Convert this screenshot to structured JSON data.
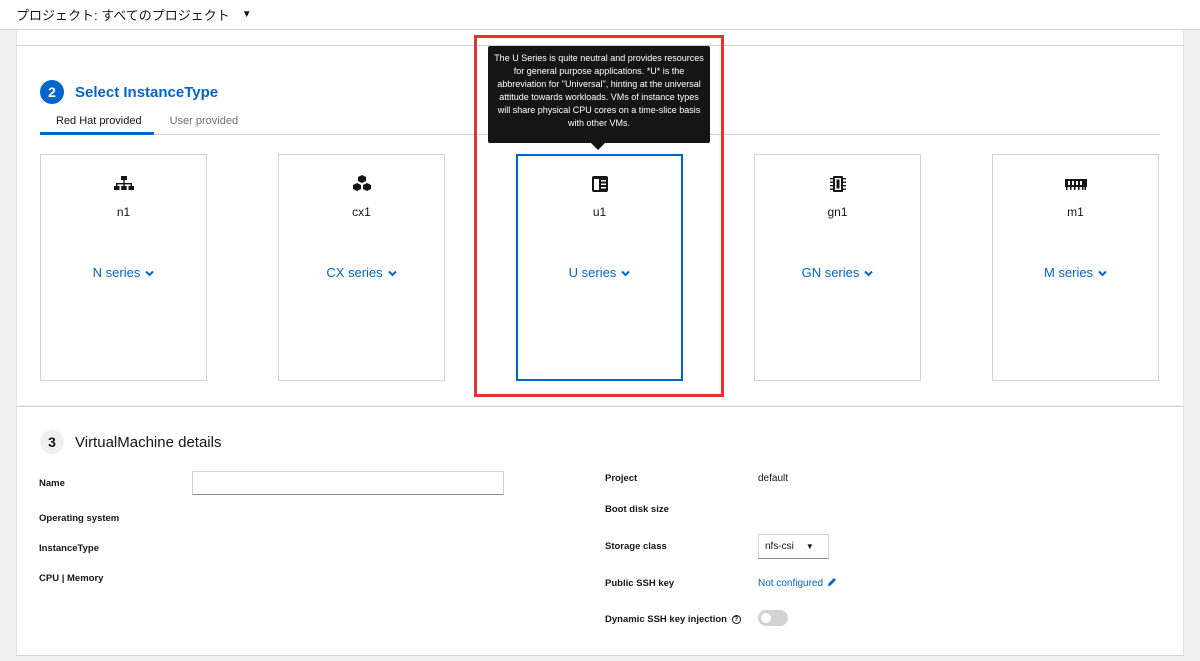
{
  "project_bar": {
    "label": "プロジェクト: すべてのプロジェクト"
  },
  "step2": {
    "number": "2",
    "title": "Select InstanceType"
  },
  "tabs": [
    {
      "label": "Red Hat provided",
      "active": true
    },
    {
      "label": "User provided",
      "active": false
    }
  ],
  "cards": [
    {
      "icon": "network-hierarchy-icon",
      "name": "n1",
      "series": "N series",
      "selected": false
    },
    {
      "icon": "cubes-icon",
      "name": "cx1",
      "series": "CX series",
      "selected": false
    },
    {
      "icon": "server-icon",
      "name": "u1",
      "series": "U series",
      "selected": true
    },
    {
      "icon": "microchip-icon",
      "name": "gn1",
      "series": "GN series",
      "selected": false
    },
    {
      "icon": "memory-icon",
      "name": "m1",
      "series": "M series",
      "selected": false
    }
  ],
  "tooltip": {
    "text": "The U Series is quite neutral and provides resources for general purpose applications. *U* is the abbreviation for \"Universal\", hinting at the universal attitude towards workloads. VMs of instance types will share physical CPU cores on a time-slice basis with other VMs."
  },
  "step3": {
    "number": "3",
    "title": "VirtualMachine details"
  },
  "details_left": {
    "name_label": "Name",
    "name_value": "",
    "os_label": "Operating system",
    "instancetype_label": "InstanceType",
    "cpu_memory_label": "CPU | Memory"
  },
  "details_right": {
    "project_label": "Project",
    "project_value": "default",
    "boot_disk_label": "Boot disk size",
    "storage_class_label": "Storage class",
    "storage_class_value": "nfs-csi",
    "ssh_key_label": "Public SSH key",
    "ssh_key_value": "Not configured",
    "dynamic_ssh_label": "Dynamic SSH key injection",
    "dynamic_ssh_enabled": false
  },
  "colors": {
    "accent": "#0066cc",
    "highlight": "#e8322b",
    "tooltip_bg": "#151515"
  }
}
